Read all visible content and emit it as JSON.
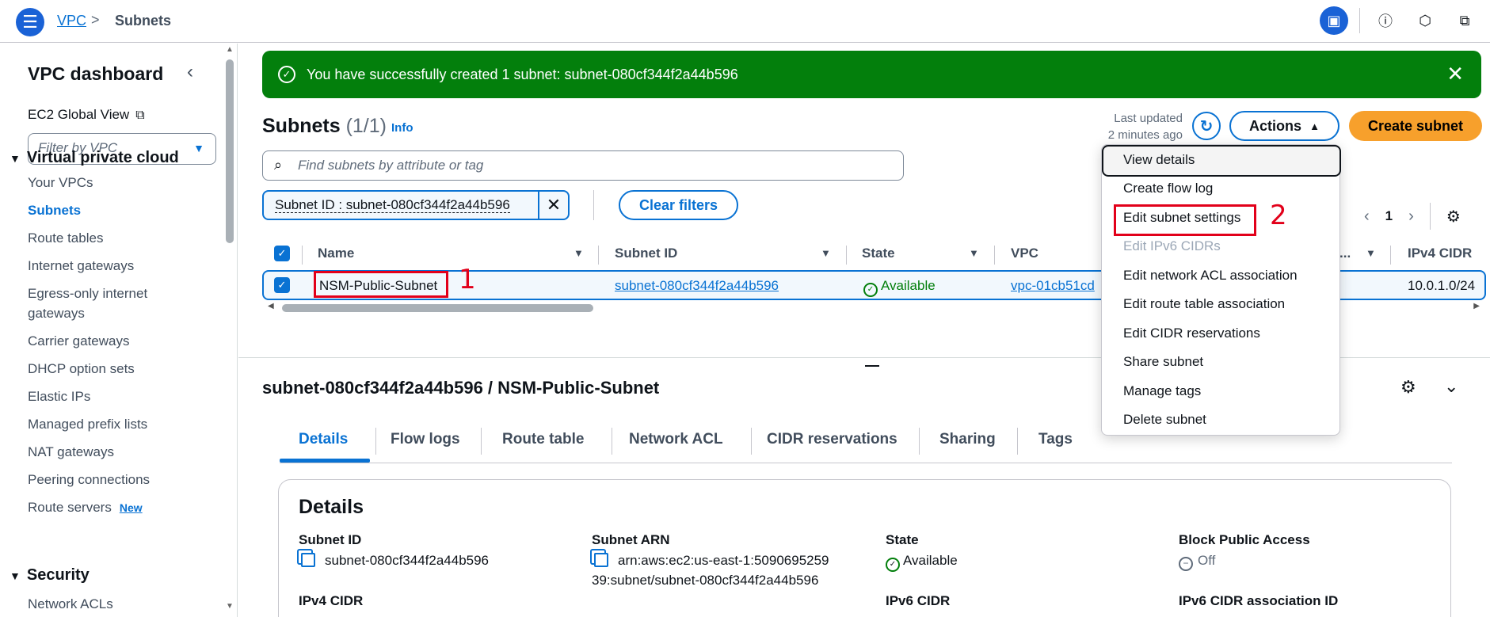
{
  "topbar": {
    "crumb_root": "VPC",
    "crumb_sep": ">",
    "crumb_current": "Subnets"
  },
  "sidebar": {
    "title": "VPC dashboard",
    "ec2_global_view": "EC2 Global View",
    "filter_placeholder": "Filter by VPC",
    "section_vpc": "Virtual private cloud",
    "items": [
      {
        "label": "Your VPCs"
      },
      {
        "label": "Subnets"
      },
      {
        "label": "Route tables"
      },
      {
        "label": "Internet gateways"
      },
      {
        "label": "Egress-only internet"
      },
      {
        "label": "gateways"
      },
      {
        "label": "Carrier gateways"
      },
      {
        "label": "DHCP option sets"
      },
      {
        "label": "Elastic IPs"
      },
      {
        "label": "Managed prefix lists"
      },
      {
        "label": "NAT gateways"
      },
      {
        "label": "Peering connections"
      },
      {
        "label": "Route servers"
      }
    ],
    "new_badge": "New",
    "section_security": "Security",
    "security_items": [
      {
        "label": "Network ACLs"
      }
    ]
  },
  "flash": {
    "message": "You have successfully created 1 subnet: subnet-080cf344f2a44b596"
  },
  "header": {
    "title": "Subnets",
    "count": "(1/1)",
    "info": "Info",
    "last_updated_1": "Last updated",
    "last_updated_2": "2 minutes ago",
    "actions": "Actions",
    "create": "Create subnet"
  },
  "search": {
    "placeholder": "Find subnets by attribute or tag"
  },
  "filter_token": "Subnet ID : subnet-080cf344f2a44b596",
  "clear_filters": "Clear filters",
  "pager": {
    "page": "1"
  },
  "table": {
    "columns": [
      "Name",
      "Subnet ID",
      "State",
      "VPC",
      "...",
      "IPv4 CIDR"
    ],
    "row": {
      "name": "NSM-Public-Subnet",
      "subnet_id": "subnet-080cf344f2a44b596",
      "state": "Available",
      "vpc": "vpc-01cb51cd",
      "ipv4": "10.0.1.0/24"
    }
  },
  "markers": {
    "one": "1",
    "two": "2"
  },
  "dropdown": {
    "items": [
      {
        "label": "View details"
      },
      {
        "label": "Create flow log"
      },
      {
        "label": "Edit subnet settings"
      },
      {
        "label": "Edit IPv6 CIDRs"
      },
      {
        "label": "Edit network ACL association"
      },
      {
        "label": "Edit route table association"
      },
      {
        "label": "Edit CIDR reservations"
      },
      {
        "label": "Share subnet"
      },
      {
        "label": "Manage tags"
      },
      {
        "label": "Delete subnet"
      }
    ]
  },
  "detail": {
    "title": "subnet-080cf344f2a44b596 / NSM-Public-Subnet",
    "tabs": [
      {
        "label": "Details"
      },
      {
        "label": "Flow logs"
      },
      {
        "label": "Route table"
      },
      {
        "label": "Network ACL"
      },
      {
        "label": "CIDR reservations"
      },
      {
        "label": "Sharing"
      },
      {
        "label": "Tags"
      }
    ],
    "card_title": "Details",
    "fields": {
      "subnet_id_label": "Subnet ID",
      "subnet_id_value": "subnet-080cf344f2a44b596",
      "subnet_arn_label": "Subnet ARN",
      "subnet_arn_value_1": "arn:aws:ec2:us-east-1:5090695259",
      "subnet_arn_value_2": "39:subnet/subnet-080cf344f2a44b596",
      "state_label": "State",
      "state_value": "Available",
      "bpa_label": "Block Public Access",
      "bpa_value": "Off",
      "ipv4_label": "IPv4 CIDR",
      "ipv6_label": "IPv6 CIDR",
      "ipv6_assoc_label": "IPv6 CIDR association ID"
    }
  },
  "colors": {
    "accent": "#0972d3",
    "success": "#037f0c",
    "primary_button": "#f7a02c",
    "annotation": "#e2001a"
  }
}
